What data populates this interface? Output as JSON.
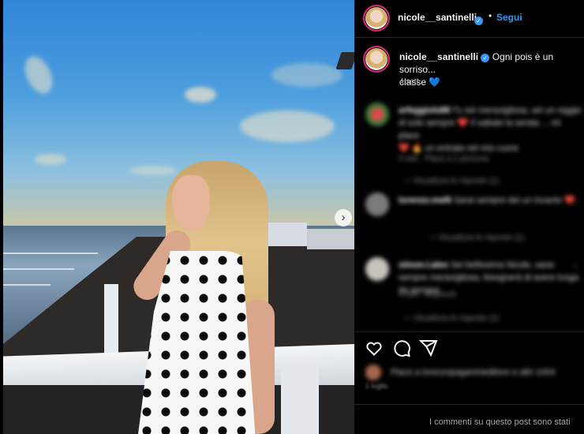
{
  "post": {
    "image_alt": "Photo of a woman in a polka dot dress at sunset by the sea"
  },
  "header": {
    "username": "nicole__santinelli",
    "verified_icon": "verified-badge-icon",
    "dot": "•",
    "follow_label": "Segui",
    "more_icon": "more-options-icon"
  },
  "caption": {
    "username": "nicole__santinelli",
    "text": "Ogni pois è un sorriso...",
    "text_line2": "classe",
    "heart_emoji": "💙",
    "time": "4 sett"
  },
  "comments": [
    {
      "username": "arfeggiolo88",
      "text": "Tu sei meravigliosa, sei un raggio di sole sempre ❤️ Il sabato la serata ... mi piace",
      "text2": "❤️ 🔥 un entrata nel mio cuore",
      "meta": "4 sett · Piace a 1 persona",
      "reply": "— Visualizza le risposte (1)"
    },
    {
      "username": "lorenzo.melli",
      "text": "Sarai sempre dei un incanto ❤️",
      "meta": "",
      "reply": "— Visualizza le risposte (1)"
    },
    {
      "username": "simon.l.alex",
      "text": "Sei bellissima Nicole, sarai sempre meravigliosa, bisognerà di avere lunga da sempre",
      "meta": "4 sett · Rispondi",
      "reply": "— Visualizza le risposte (1)"
    }
  ],
  "actions": {
    "like_icon": "heart-icon",
    "comment_icon": "comment-icon",
    "share_icon": "share-icon"
  },
  "likes": {
    "text": "Piace a lorenzopaganinieditore e altri 1004"
  },
  "date": "1 luglio",
  "footer": {
    "text": "I commenti su questo post sono stati"
  }
}
